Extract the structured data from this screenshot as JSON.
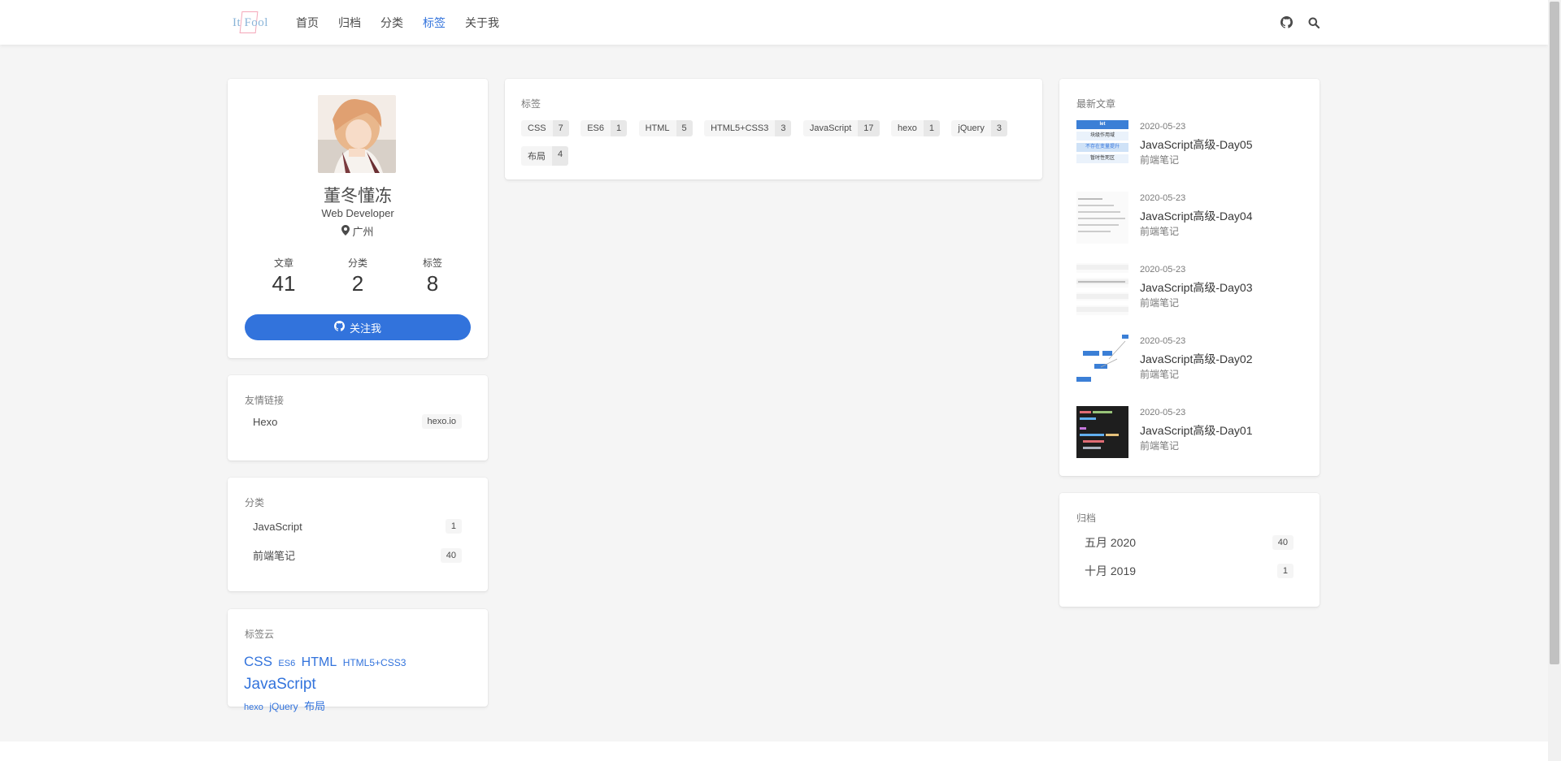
{
  "nav": {
    "logo_text": "It Fool",
    "links": [
      "首页",
      "归档",
      "分类",
      "标签",
      "关于我"
    ],
    "active_index": 3
  },
  "profile": {
    "name": "董冬懂冻",
    "title": "Web Developer",
    "location": "广州",
    "stats": [
      {
        "label": "文章",
        "value": "41"
      },
      {
        "label": "分类",
        "value": "2"
      },
      {
        "label": "标签",
        "value": "8"
      }
    ],
    "follow_label": "关注我"
  },
  "links_card": {
    "label": "友情链接",
    "items": [
      {
        "name": "Hexo",
        "host": "hexo.io"
      }
    ]
  },
  "categories_card": {
    "label": "分类",
    "items": [
      {
        "name": "JavaScript",
        "count": "1"
      },
      {
        "name": "前端笔记",
        "count": "40"
      }
    ]
  },
  "tagcloud": {
    "label": "标签云",
    "items": [
      "CSS",
      "ES6",
      "HTML",
      "HTML5+CSS3",
      "JavaScript",
      "hexo",
      "jQuery",
      "布局"
    ]
  },
  "tags_card": {
    "label": "标签",
    "tags": [
      {
        "name": "CSS",
        "count": "7"
      },
      {
        "name": "ES6",
        "count": "1"
      },
      {
        "name": "HTML",
        "count": "5"
      },
      {
        "name": "HTML5+CSS3",
        "count": "3"
      },
      {
        "name": "JavaScript",
        "count": "17"
      },
      {
        "name": "hexo",
        "count": "1"
      },
      {
        "name": "jQuery",
        "count": "3"
      },
      {
        "name": "布局",
        "count": "4"
      }
    ]
  },
  "recent": {
    "label": "最新文章",
    "posts": [
      {
        "date": "2020-05-23",
        "title": "JavaScript高级-Day05",
        "category": "前端笔记"
      },
      {
        "date": "2020-05-23",
        "title": "JavaScript高级-Day04",
        "category": "前端笔记"
      },
      {
        "date": "2020-05-23",
        "title": "JavaScript高级-Day03",
        "category": "前端笔记"
      },
      {
        "date": "2020-05-23",
        "title": "JavaScript高级-Day02",
        "category": "前端笔记"
      },
      {
        "date": "2020-05-23",
        "title": "JavaScript高级-Day01",
        "category": "前端笔记"
      }
    ]
  },
  "archive": {
    "label": "归档",
    "items": [
      {
        "month": "五月 2020",
        "count": "40"
      },
      {
        "month": "十月 2019",
        "count": "1"
      }
    ]
  },
  "thumb_text": {
    "day05": [
      "let",
      "块级作用域",
      "不存在变量提升",
      "暂时性死区"
    ]
  },
  "colors": {
    "accent": "#3273dc",
    "background": "#f5f5f5",
    "card": "#ffffff"
  }
}
